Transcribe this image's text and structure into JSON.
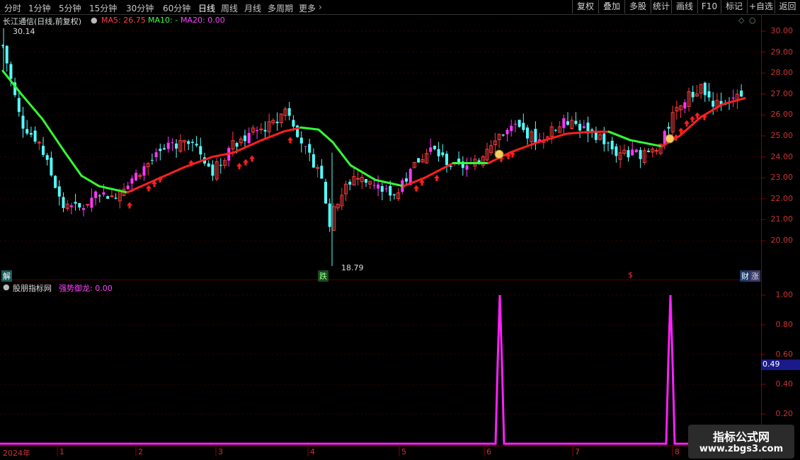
{
  "toolbar": {
    "periods": [
      "分时",
      "1分钟",
      "5分钟",
      "15分钟",
      "30分钟",
      "60分钟",
      "日线",
      "周线",
      "月线",
      "多周期",
      "更多"
    ],
    "active_period": "日线",
    "tools": [
      "复权",
      "叠加",
      "多股",
      "统计",
      "画线",
      "F10",
      "+自选",
      "返回"
    ]
  },
  "main_panel": {
    "title": "长江通信(日线,前复权)",
    "ma5_label": "MA5: 26.75",
    "ma10_label": "MA10: -",
    "ma20_label": "MA20: 0.00",
    "max_label": "30.14",
    "min_label": "18.79",
    "price_axis": [
      "30.00",
      "29.00",
      "28.00",
      "27.00",
      "26.00",
      "25.00",
      "24.00",
      "23.00",
      "22.00",
      "21.00",
      "20.00"
    ],
    "tags": {
      "left": "解",
      "mid": "跌",
      "dollar": "$",
      "right1": "财",
      "right2": "涨"
    },
    "colors": {
      "up": "#ff3c3c",
      "up_fill": "#ff38ff",
      "down": "#54ffff",
      "ma_up": "#ff2020",
      "ma_down": "#33ff33"
    }
  },
  "indicator_panel": {
    "source": "股朋指标网",
    "name": "强势御龙: 0.00",
    "axis": [
      "1.00",
      "0.80",
      "0.60",
      "0.40",
      "0.20"
    ],
    "cursor_value": "0.49",
    "line_color": "#ff20ff"
  },
  "date_axis": [
    "2024年",
    "1",
    "2",
    "3",
    "4",
    "5",
    "6",
    "7",
    "8"
  ],
  "watermark": {
    "line1": "指标公式网",
    "line2": "www.zbgs3.com"
  },
  "chart_data": {
    "type": "candlestick",
    "title": "长江通信(日线,前复权)",
    "price_range": [
      19.5,
      30.4
    ],
    "months": [
      "1",
      "2",
      "3",
      "4",
      "5",
      "6",
      "7",
      "8"
    ],
    "annotations": {
      "high": 30.14,
      "low": 18.79
    },
    "ma5_last": 26.75,
    "indicator": {
      "name": "强势御龙",
      "range": [
        0,
        1
      ],
      "spikes_near": [
        "6",
        "8"
      ],
      "last": 0.0
    }
  }
}
